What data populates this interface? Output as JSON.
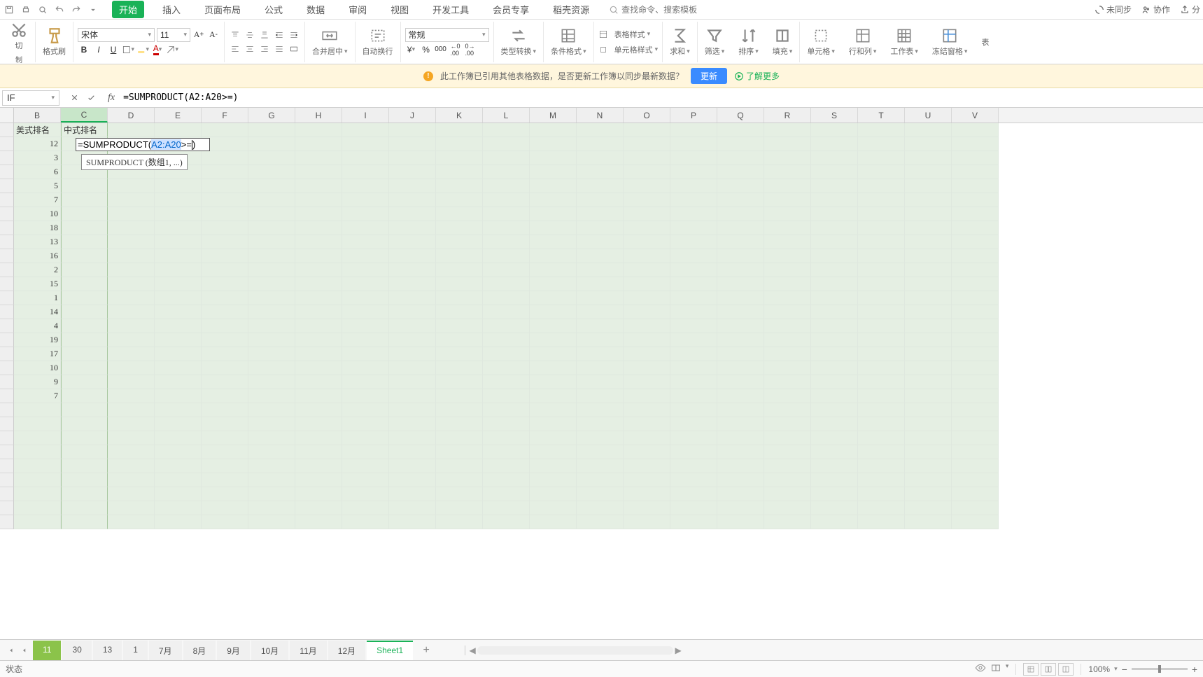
{
  "menu": {
    "tabs": [
      "开始",
      "插入",
      "页面布局",
      "公式",
      "数据",
      "审阅",
      "视图",
      "开发工具",
      "会员专享",
      "稻壳资源"
    ],
    "active": "开始",
    "search_placeholder": "查找命令、搜索模板"
  },
  "top_right": {
    "unsync": "未同步",
    "collab": "协作",
    "share": "分"
  },
  "ribbon": {
    "cut": "切",
    "copy": "制",
    "format_painter": "格式刷",
    "font_name": "宋体",
    "font_size": "11",
    "merge_center": "合并居中",
    "auto_wrap": "自动换行",
    "number_format": "常规",
    "type_convert": "类型转换",
    "cond_format": "条件格式",
    "table_style": "表格样式",
    "cell_style": "单元格样式",
    "sum": "求和",
    "filter": "筛选",
    "sort": "排序",
    "fill": "填充",
    "cell": "单元格",
    "rowcol": "行和列",
    "sheet": "工作表",
    "freeze": "冻结窗格",
    "table": "表"
  },
  "banner": {
    "message": "此工作簿已引用其他表格数据，是否更新工作簿以同步最新数据？",
    "update_btn": "更新",
    "link": "了解更多"
  },
  "formula_bar": {
    "cell_name": "IF",
    "formula": "=SUMPRODUCT(A2:A20>=)"
  },
  "columns": [
    "B",
    "C",
    "D",
    "E",
    "F",
    "G",
    "H",
    "I",
    "J",
    "K",
    "L",
    "M",
    "N",
    "O",
    "P",
    "Q",
    "R",
    "S",
    "T",
    "U",
    "V"
  ],
  "headers_row": {
    "B": "美式排名",
    "C": "中式排名"
  },
  "col_b_values": [
    "12",
    "3",
    "6",
    "5",
    "7",
    "10",
    "18",
    "13",
    "16",
    "2",
    "15",
    "1",
    "14",
    "4",
    "19",
    "17",
    "10",
    "9",
    "7"
  ],
  "cell_editor": {
    "prefix": "=SUMPRODUCT(",
    "ref": "A2:A20",
    "suffix_before_cursor": ">=",
    "suffix_after_cursor": ")"
  },
  "tooltip": "SUMPRODUCT (数组1, ...)",
  "sheet_tabs": [
    "11",
    "30",
    "13",
    "1",
    "7月",
    "8月",
    "9月",
    "10月",
    "11月",
    "12月",
    "Sheet1"
  ],
  "status": {
    "mode": "状态",
    "zoom": "100%"
  }
}
